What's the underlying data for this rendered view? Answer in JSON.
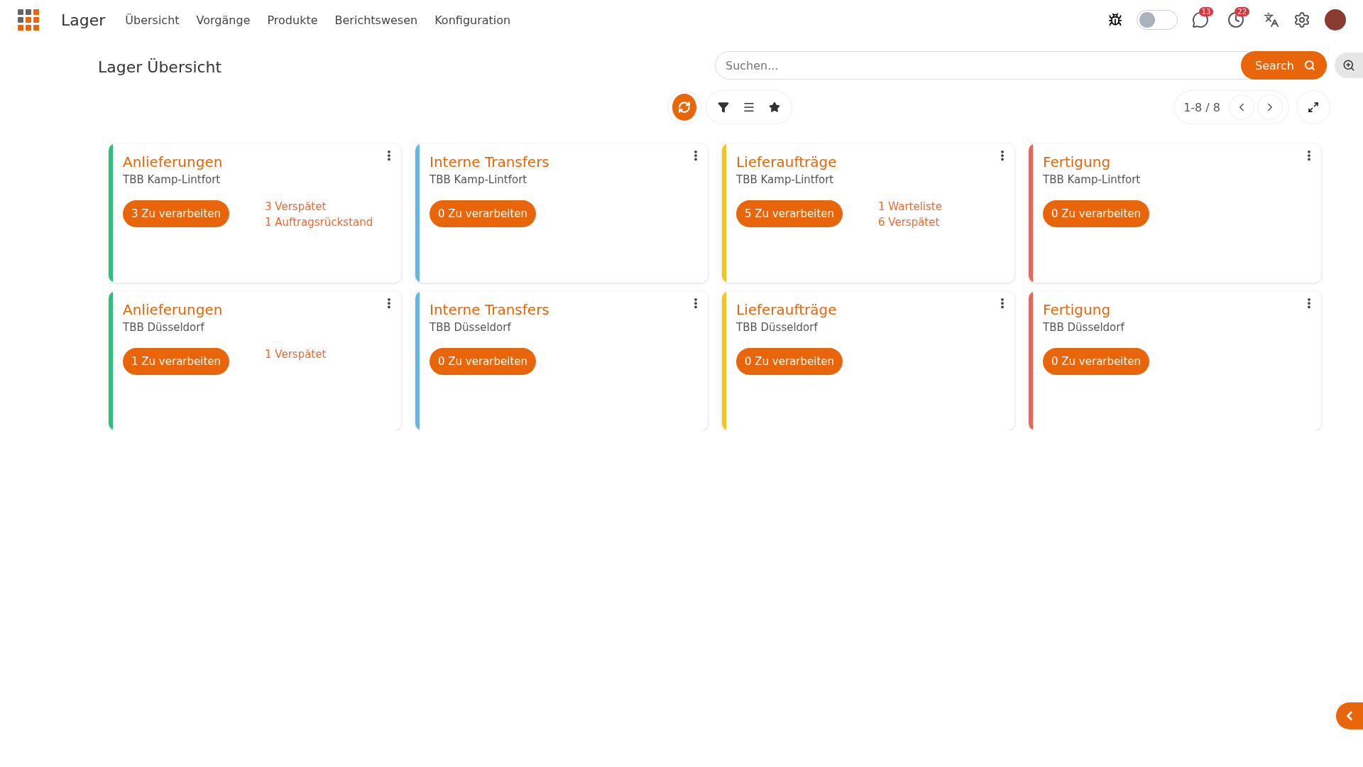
{
  "app": {
    "title": "Lager"
  },
  "menu": [
    {
      "label": "Übersicht"
    },
    {
      "label": "Vorgänge"
    },
    {
      "label": "Produkte"
    },
    {
      "label": "Berichtswesen"
    },
    {
      "label": "Konfiguration"
    }
  ],
  "topbar": {
    "debug_toggle": {
      "on": false
    },
    "messages_badge": "13",
    "activities_badge": "22"
  },
  "page_title": "Lager Übersicht",
  "search": {
    "placeholder": "Suchen...",
    "button": "Search"
  },
  "pager": {
    "range": "1-8 / 8"
  },
  "cards": [
    {
      "title": "Anlieferungen",
      "warehouse": "TBB Kamp-Lintfort",
      "action": "3 Zu verarbeiten",
      "stats": [
        "3 Verspätet",
        "1 Auftragsrückstand"
      ],
      "color": "#2ebf7f"
    },
    {
      "title": "Interne Transfers",
      "warehouse": "TBB Kamp-Lintfort",
      "action": "0 Zu verarbeiten",
      "color": "#63b6e6"
    },
    {
      "title": "Lieferaufträge",
      "warehouse": "TBB Kamp-Lintfort",
      "action": "5 Zu verarbeiten",
      "stats": [
        "1 Warteliste",
        "6 Verspätet"
      ],
      "color": "#f5c518"
    },
    {
      "title": "Fertigung",
      "warehouse": "TBB Kamp-Lintfort",
      "action": "0 Zu verarbeiten",
      "color": "#ef6351"
    },
    {
      "title": "Anlieferungen",
      "warehouse": "TBB Düsseldorf",
      "action": "1 Zu verarbeiten",
      "stats": [
        "1 Verspätet"
      ],
      "color": "#2ebf7f"
    },
    {
      "title": "Interne Transfers",
      "warehouse": "TBB Düsseldorf",
      "action": "0 Zu verarbeiten",
      "color": "#63b6e6"
    },
    {
      "title": "Lieferaufträge",
      "warehouse": "TBB Düsseldorf",
      "action": "0 Zu verarbeiten",
      "color": "#f5c518"
    },
    {
      "title": "Fertigung",
      "warehouse": "TBB Düsseldorf",
      "action": "0 Zu verarbeiten",
      "color": "#ef6351"
    }
  ]
}
